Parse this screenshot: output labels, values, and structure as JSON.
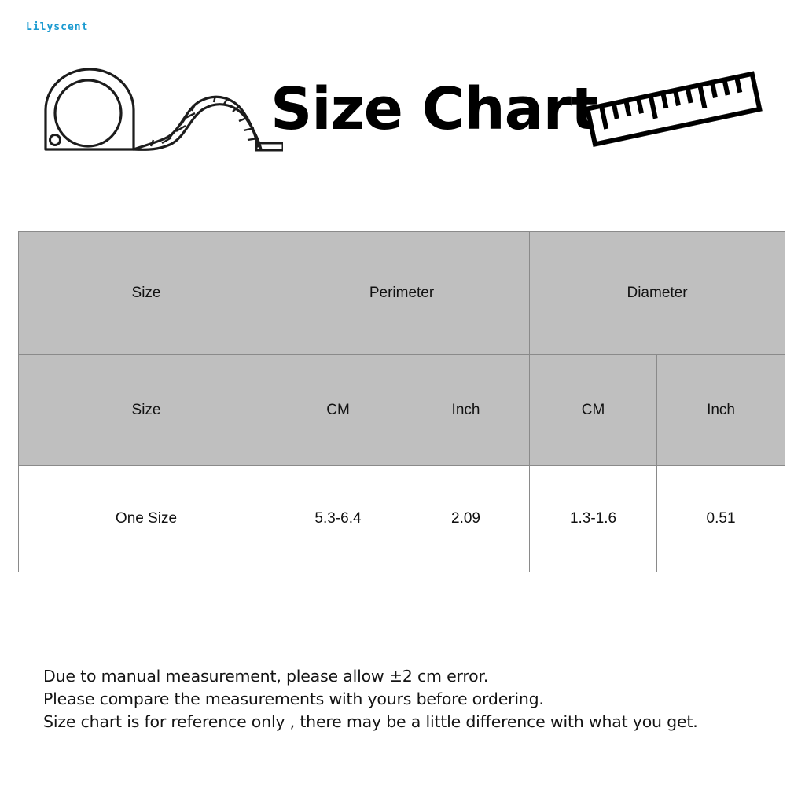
{
  "watermark": {
    "text": "Lilyscent",
    "color": "#1a9ad0"
  },
  "header": {
    "title": "Size Chart",
    "left_icon": "tape-measure-icon",
    "right_icon": "ruler-icon"
  },
  "table": {
    "header_bg": "#bfbfbf",
    "border_color": "#8a8a8a",
    "group_headers": [
      {
        "label": "Size",
        "colspan": 1
      },
      {
        "label": "Perimeter",
        "colspan": 2
      },
      {
        "label": "Diameter",
        "colspan": 2
      }
    ],
    "sub_headers": [
      "Size",
      "CM",
      "Inch",
      "CM",
      "Inch"
    ],
    "rows": [
      [
        "One Size",
        "5.3-6.4",
        "2.09",
        "1.3-1.6",
        "0.51"
      ]
    ]
  },
  "notes": [
    "Due to manual measurement, please allow ±2 cm error.",
    "Please compare the measurements with yours before ordering.",
    "Size chart is for reference only , there may be a little difference with what you get."
  ],
  "chart_data": {
    "type": "table",
    "title": "Size Chart",
    "columns": [
      "Size",
      "Perimeter CM",
      "Perimeter Inch",
      "Diameter CM",
      "Diameter Inch"
    ],
    "rows": [
      [
        "One Size",
        "5.3-6.4",
        "2.09",
        "1.3-1.6",
        "0.51"
      ]
    ]
  }
}
